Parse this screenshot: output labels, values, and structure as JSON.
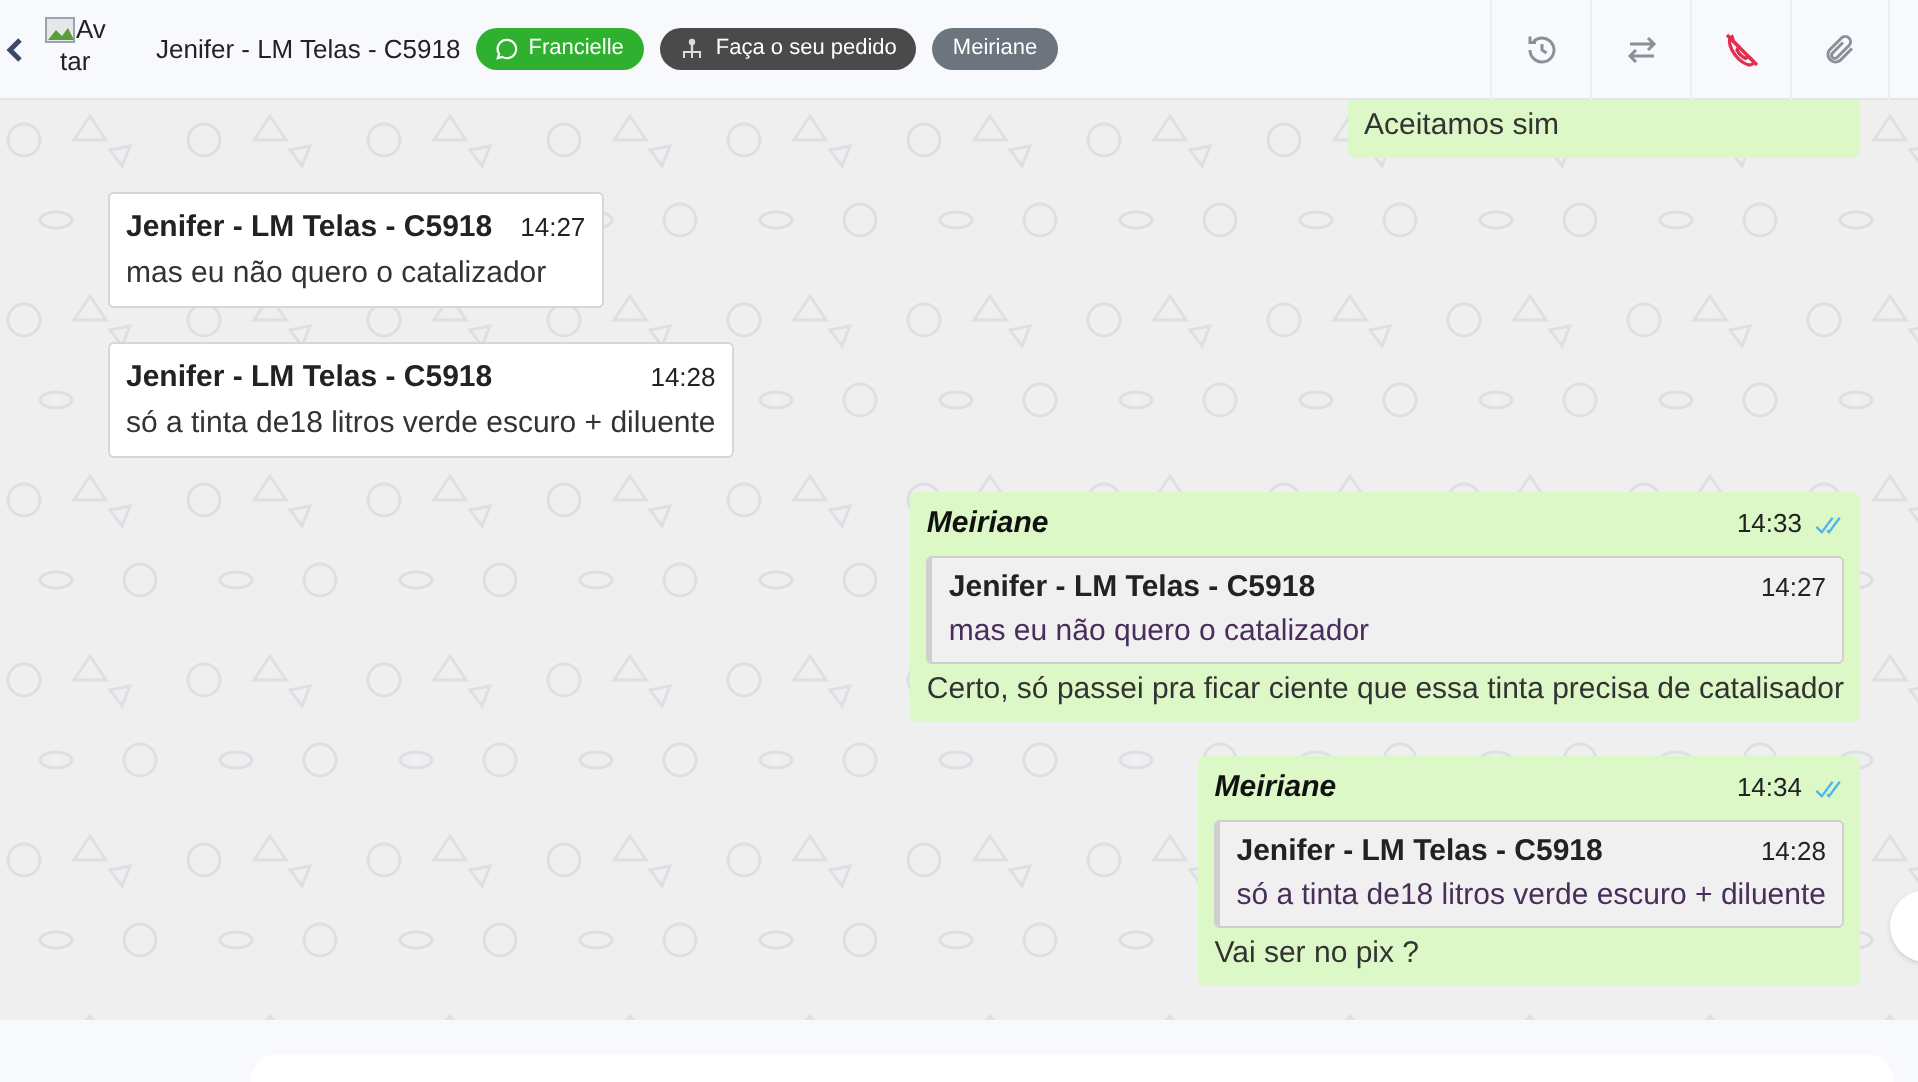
{
  "header": {
    "avatar_alt": [
      "Av",
      "tar"
    ],
    "contact": "Jenifer - LM Telas - C5918",
    "tags": [
      {
        "kind": "channel",
        "label": "Francielle"
      },
      {
        "kind": "order",
        "label": "Faça o seu pedido"
      },
      {
        "kind": "agent",
        "label": "Meiriane"
      }
    ]
  },
  "messages": [
    {
      "kind": "outgoing",
      "text": "Aceitamos sim"
    },
    {
      "kind": "incoming",
      "sender": "Jenifer - LM Telas - C5918",
      "time": "14:27",
      "text": "mas eu não quero o catalizador"
    },
    {
      "kind": "incoming",
      "sender": "Jenifer - LM Telas - C5918",
      "time": "14:28",
      "text": "só a tinta de18 litros verde escuro + diluente"
    },
    {
      "kind": "outgoing",
      "sender": "Meiriane",
      "time": "14:33",
      "read": true,
      "quote": {
        "sender": "Jenifer - LM Telas - C5918",
        "time": "14:27",
        "text": "mas eu não quero o catalizador"
      },
      "text": "Certo, só passei pra ficar ciente que essa tinta precisa de catalisador"
    },
    {
      "kind": "outgoing",
      "sender": "Meiriane",
      "time": "14:34",
      "read": true,
      "quote": {
        "sender": "Jenifer - LM Telas - C5918",
        "time": "14:28",
        "text": "só a tinta de18 litros verde escuro + diluente"
      },
      "text": "Vai ser no pix ?"
    }
  ]
}
